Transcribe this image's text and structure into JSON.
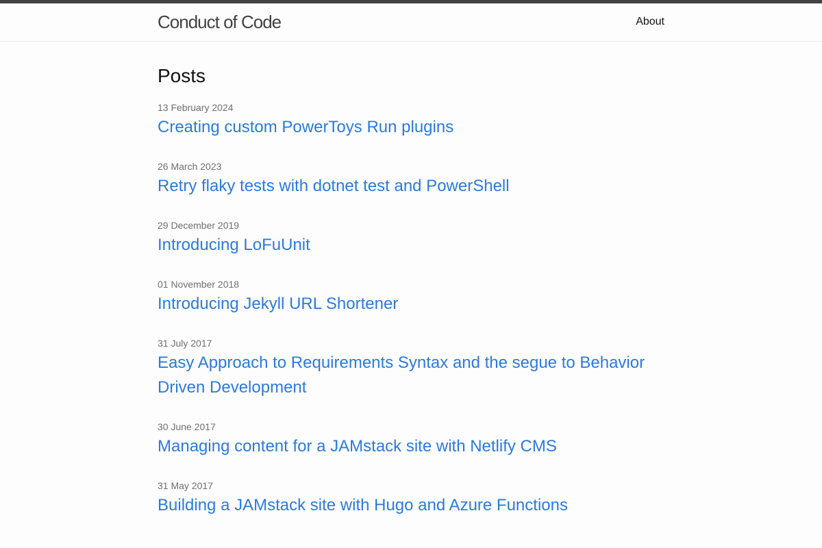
{
  "header": {
    "site_title": "Conduct of Code",
    "nav": [
      {
        "label": "About"
      }
    ]
  },
  "main": {
    "heading": "Posts",
    "posts": [
      {
        "date": "13 February 2024",
        "title": "Creating custom PowerToys Run plugins"
      },
      {
        "date": "26 March 2023",
        "title": "Retry flaky tests with dotnet test and PowerShell"
      },
      {
        "date": "29 December 2019",
        "title": "Introducing LoFuUnit"
      },
      {
        "date": "01 November 2018",
        "title": "Introducing Jekyll URL Shortener"
      },
      {
        "date": "31 July 2017",
        "title": "Easy Approach to Requirements Syntax and the segue to Behavior Driven Development"
      },
      {
        "date": "30 June 2017",
        "title": "Managing content for a JAMstack site with Netlify CMS"
      },
      {
        "date": "31 May 2017",
        "title": "Building a JAMstack site with Hugo and Azure Functions"
      }
    ]
  },
  "colors": {
    "link": "#2a7ae2",
    "meta": "#6f6f6f",
    "top_rule": "#424242",
    "background": "#fdfdfd"
  }
}
